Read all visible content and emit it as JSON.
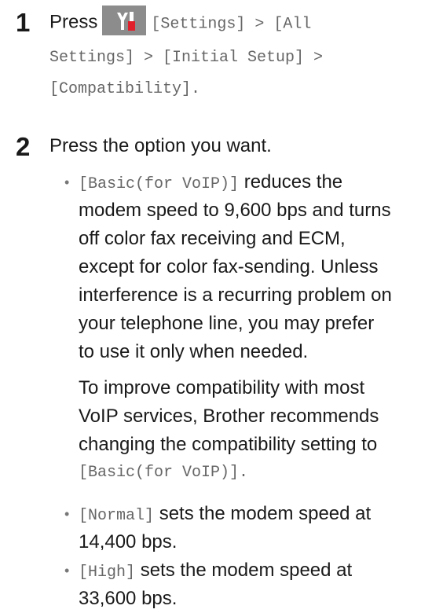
{
  "step1": {
    "number": "1",
    "press": "Press",
    "icon": "settings-tools-icon",
    "path_line1_a": "[Settings] > [All",
    "path_line2": "Settings] > [Initial Setup] >",
    "path_line3": "[Compatibility]."
  },
  "step2": {
    "number": "2",
    "intro": "Press the option you want.",
    "basic": {
      "code": "[Basic(for VoIP)]",
      "line1": "reduces the",
      "line2": "modem speed to 9,600 bps and turns",
      "line3": "off color fax receiving and ECM,",
      "line4": "except for color fax-sending. Unless",
      "line5": "interference is a recurring problem on",
      "line6": "your telephone line, you may prefer",
      "line7": "to use it only when needed."
    },
    "note": {
      "line1": "To improve compatibility with most",
      "line2": "VoIP services, Brother recommends",
      "line3": "changing the compatibility setting to",
      "code": "[Basic(for VoIP)]."
    },
    "normal": {
      "code": "[Normal]",
      "line1": "sets the modem speed at",
      "line2": "14,400 bps."
    },
    "high": {
      "code": "[High]",
      "line1": "sets the modem speed at",
      "line2": "33,600 bps."
    }
  },
  "colors": {
    "button_bg": "#8c8c8c",
    "screwdriver_red": "#e0202a",
    "code_text": "#666666"
  }
}
